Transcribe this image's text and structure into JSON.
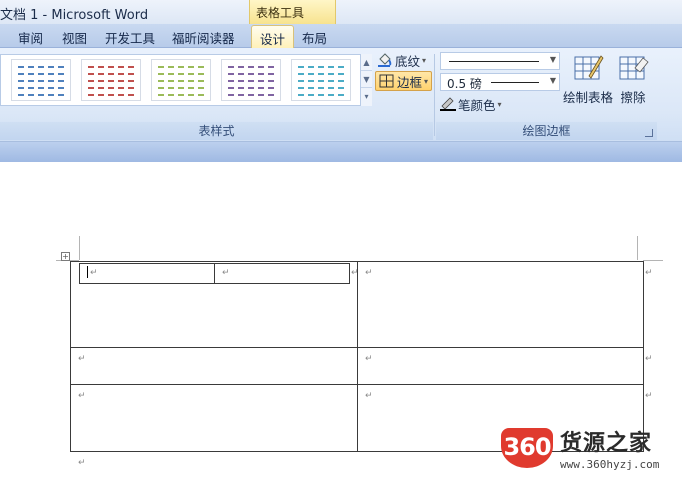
{
  "window": {
    "title": "文档 1 - Microsoft Word"
  },
  "context_tab_header": "表格工具",
  "tabs": [
    {
      "label": "审阅",
      "active": false
    },
    {
      "label": "视图",
      "active": false
    },
    {
      "label": "开发工具",
      "active": false
    },
    {
      "label": "福昕阅读器",
      "active": false
    },
    {
      "label": "设计",
      "active": true
    },
    {
      "label": "布局",
      "active": false
    }
  ],
  "ribbon": {
    "table_styles": {
      "group_label": "表样式",
      "style_colors": [
        "#4f81bd",
        "#c0504d",
        "#9bbb59",
        "#8064a2",
        "#4bacc6"
      ],
      "shading_label": "底纹",
      "borders_label": "边框"
    },
    "draw_borders": {
      "group_label": "绘图边框",
      "line_weight": "0.5 磅",
      "pen_color_label": "笔颜色",
      "draw_table_label": "绘制表格",
      "eraser_label": "擦除"
    }
  },
  "document": {
    "paragraph_mark": "↵"
  },
  "watermark": {
    "badge": "360",
    "name": "货源之家",
    "url": "www.360hyzj.com"
  }
}
